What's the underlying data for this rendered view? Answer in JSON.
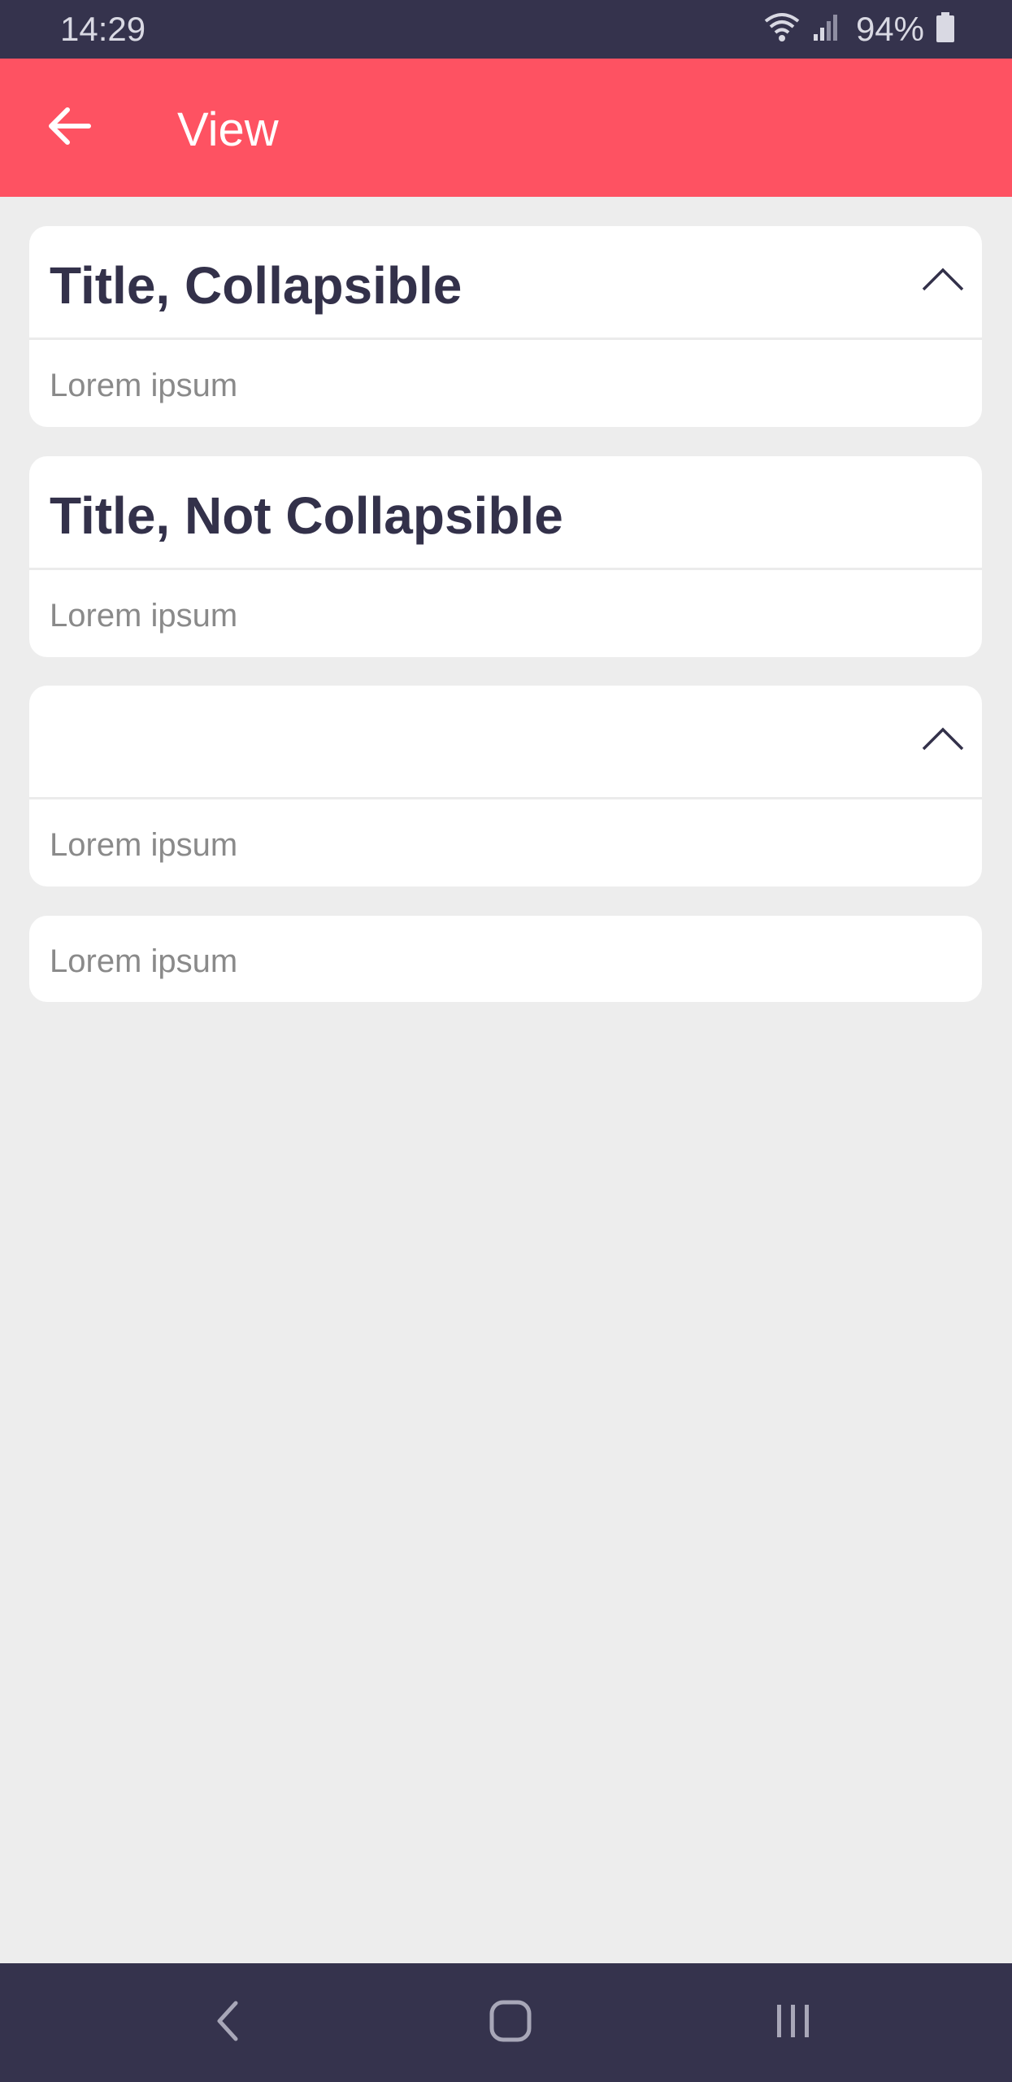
{
  "status_bar": {
    "time": "14:29",
    "battery": "94%",
    "icons": [
      "wifi-icon",
      "signal-icon",
      "battery-icon"
    ]
  },
  "app_bar": {
    "title": "View",
    "back_icon": "arrow-left-icon",
    "color": "#fe5262"
  },
  "cards": [
    {
      "title": "Title, Collapsible",
      "body": "Lorem ipsum",
      "collapsible": true
    },
    {
      "title": "Title, Not Collapsible",
      "body": "Lorem ipsum",
      "collapsible": false
    },
    {
      "title": "",
      "body": "Lorem ipsum",
      "collapsible": true
    },
    {
      "body": "Lorem ipsum"
    }
  ],
  "nav_bar": {
    "icons": [
      "back-nav-icon",
      "home-nav-icon",
      "recents-nav-icon"
    ]
  },
  "colors": {
    "status_bar": "#35334d",
    "title_text": "#33314a",
    "body_text": "#8a8a8a",
    "background": "#ededed"
  }
}
